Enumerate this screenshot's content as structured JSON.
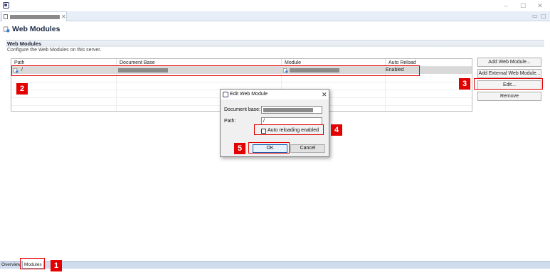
{
  "window": {
    "minimize_glyph": "–",
    "maximize_glyph": "☐",
    "close_glyph": "✕"
  },
  "editor_tab": {
    "close_glyph": "✕",
    "minimize_glyph": "▭",
    "maximize_glyph": "▢"
  },
  "form": {
    "title": "Web Modules",
    "section_title": "Web Modules",
    "section_description": "Configure the Web Modules on this server."
  },
  "table": {
    "columns": [
      "Path",
      "Document Base",
      "Module",
      "Auto Reload"
    ],
    "rows": [
      {
        "path": "/",
        "auto_reload": "Enabled"
      }
    ]
  },
  "side_buttons": {
    "add_web_module": "Add Web Module...",
    "add_external_web_module": "Add External Web Module...",
    "edit": "Edit...",
    "remove": "Remove"
  },
  "dialog": {
    "title": "Edit Web Module",
    "close_glyph": "✕",
    "document_base_label": "Document base:",
    "path_label": "Path:",
    "path_value": "/",
    "auto_reload_label": "Auto reloading enabled",
    "ok_label": "OK",
    "cancel_label": "Cancel"
  },
  "bottom_tabs": [
    "Overview",
    "Modules"
  ],
  "annotations": [
    "1",
    "2",
    "3",
    "4",
    "5"
  ],
  "colors": {
    "annotation": "#e30000",
    "selection": "#d9d9d9",
    "default_button_border": "#1a5fb4"
  }
}
